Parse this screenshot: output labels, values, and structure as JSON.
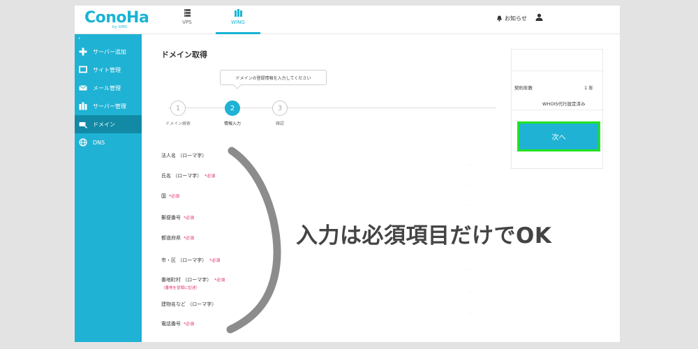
{
  "header": {
    "logo_text": "ConoHa",
    "logo_sub": "by GMO",
    "nav": [
      {
        "label": "VPS"
      },
      {
        "label": "WING"
      }
    ],
    "notice_label": "お知らせ"
  },
  "sidebar": {
    "collapse_glyph": "‹",
    "items": [
      {
        "label": "サーバー追加",
        "icon": "plus-icon"
      },
      {
        "label": "サイト管理",
        "icon": "monitor-icon"
      },
      {
        "label": "メール管理",
        "icon": "mail-icon"
      },
      {
        "label": "サーバー管理",
        "icon": "server-icon"
      },
      {
        "label": "ドメイン",
        "icon": "domain-icon",
        "active": true
      },
      {
        "label": "DNS",
        "icon": "globe-icon"
      }
    ]
  },
  "main": {
    "title": "ドメイン取得",
    "tooltip": "ドメインの登録情報を入力してください",
    "steps": [
      {
        "number": "1",
        "label": "ドメイン検索"
      },
      {
        "number": "2",
        "label": "情報入力"
      },
      {
        "number": "3",
        "label": "確認"
      }
    ],
    "form_fields": [
      {
        "label": "法人名 （ローマ字）",
        "required": ""
      },
      {
        "label": "氏名 （ローマ字）",
        "required": "*必須"
      },
      {
        "label": "国",
        "required": "*必須"
      },
      {
        "label": "郵便番号",
        "required": "*必須"
      },
      {
        "label": "都道府県",
        "required": "*必須"
      },
      {
        "label": "市・区 （ローマ字）",
        "required": "*必須"
      },
      {
        "label": "番地町村 （ローマ字）",
        "required": "*必須",
        "note": "（番地を冒頭に記述）"
      },
      {
        "label": "建物名など （ローマ字）",
        "required": ""
      },
      {
        "label": "電話番号",
        "required": "*必須"
      }
    ],
    "field_dots": "..."
  },
  "summary": {
    "contract_label": "契約年数",
    "contract_value": "1 年",
    "whois_label": "WHOIS代行設定済み",
    "next_button": "次へ"
  },
  "overlay": {
    "caption": "入力は必須項目だけでOK"
  },
  "colors": {
    "brand": "#1fb2d4",
    "active_sidebar": "#128aa6",
    "required": "#e0306d",
    "highlight": "#21e321"
  }
}
